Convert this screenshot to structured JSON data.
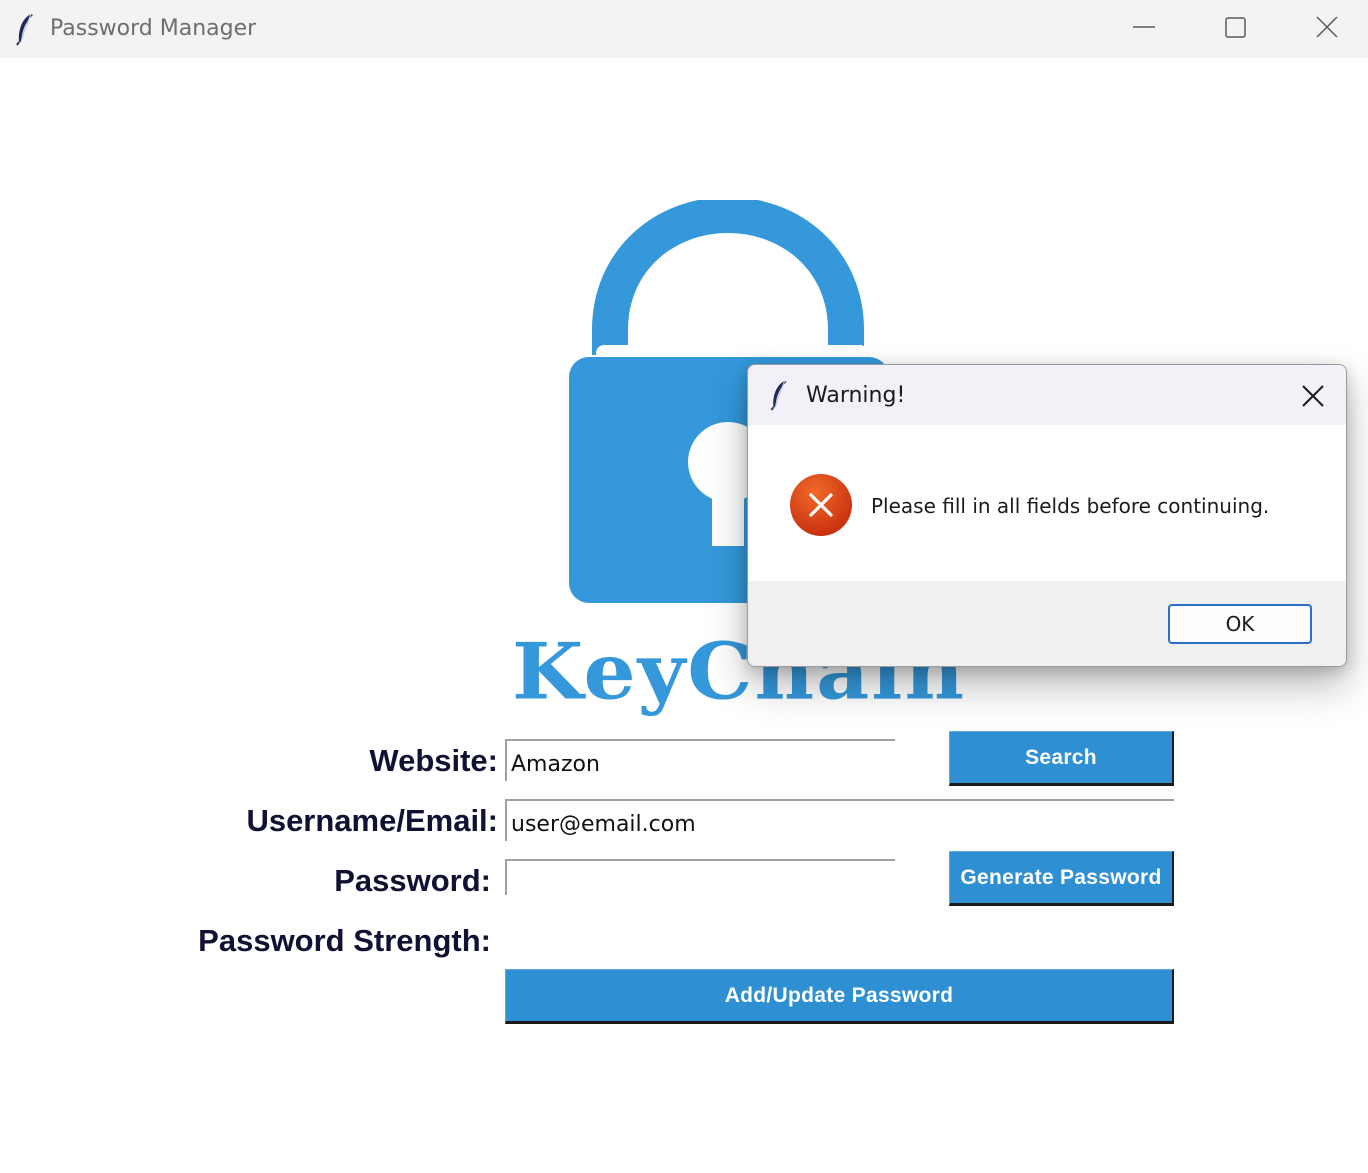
{
  "window": {
    "title": "Password Manager",
    "app_icon": "feather-icon",
    "controls": [
      "minimize-icon",
      "maximize-icon",
      "close-icon"
    ]
  },
  "logo": {
    "text": "KeyChain",
    "icon": "padlock-icon",
    "color": "#3498db"
  },
  "form": {
    "website_label": "Website:",
    "website_value": "Amazon",
    "username_label": "Username/Email:",
    "username_value": "user@email.com",
    "password_label": "Password:",
    "password_value": "",
    "strength_label": "Password Strength:",
    "search_button": "Search",
    "generate_button": "Generate Password",
    "add_update_button": "Add/Update Password"
  },
  "dialog": {
    "title": "Warning!",
    "message": "Please fill in all fields before continuing.",
    "icon": "error-icon",
    "ok_button": "OK"
  },
  "colors": {
    "accent": "#3498db",
    "button": "#2f8fd3",
    "label_text": "#111133",
    "error": "#d9431a"
  }
}
